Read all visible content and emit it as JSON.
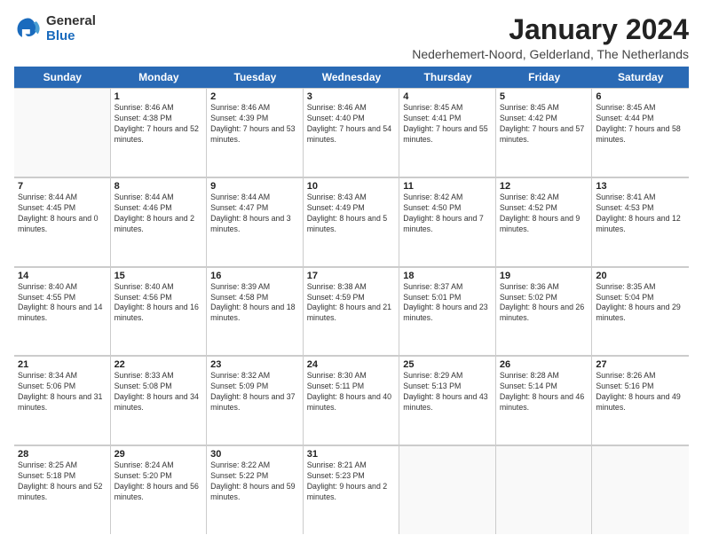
{
  "logo": {
    "general": "General",
    "blue": "Blue"
  },
  "title": "January 2024",
  "location": "Nederhemert-Noord, Gelderland, The Netherlands",
  "days": [
    "Sunday",
    "Monday",
    "Tuesday",
    "Wednesday",
    "Thursday",
    "Friday",
    "Saturday"
  ],
  "weeks": [
    [
      {
        "day": "",
        "sunrise": "",
        "sunset": "",
        "daylight": "",
        "empty": true
      },
      {
        "day": "1",
        "sunrise": "Sunrise: 8:46 AM",
        "sunset": "Sunset: 4:38 PM",
        "daylight": "Daylight: 7 hours and 52 minutes."
      },
      {
        "day": "2",
        "sunrise": "Sunrise: 8:46 AM",
        "sunset": "Sunset: 4:39 PM",
        "daylight": "Daylight: 7 hours and 53 minutes."
      },
      {
        "day": "3",
        "sunrise": "Sunrise: 8:46 AM",
        "sunset": "Sunset: 4:40 PM",
        "daylight": "Daylight: 7 hours and 54 minutes."
      },
      {
        "day": "4",
        "sunrise": "Sunrise: 8:45 AM",
        "sunset": "Sunset: 4:41 PM",
        "daylight": "Daylight: 7 hours and 55 minutes."
      },
      {
        "day": "5",
        "sunrise": "Sunrise: 8:45 AM",
        "sunset": "Sunset: 4:42 PM",
        "daylight": "Daylight: 7 hours and 57 minutes."
      },
      {
        "day": "6",
        "sunrise": "Sunrise: 8:45 AM",
        "sunset": "Sunset: 4:44 PM",
        "daylight": "Daylight: 7 hours and 58 minutes."
      }
    ],
    [
      {
        "day": "7",
        "sunrise": "Sunrise: 8:44 AM",
        "sunset": "Sunset: 4:45 PM",
        "daylight": "Daylight: 8 hours and 0 minutes."
      },
      {
        "day": "8",
        "sunrise": "Sunrise: 8:44 AM",
        "sunset": "Sunset: 4:46 PM",
        "daylight": "Daylight: 8 hours and 2 minutes."
      },
      {
        "day": "9",
        "sunrise": "Sunrise: 8:44 AM",
        "sunset": "Sunset: 4:47 PM",
        "daylight": "Daylight: 8 hours and 3 minutes."
      },
      {
        "day": "10",
        "sunrise": "Sunrise: 8:43 AM",
        "sunset": "Sunset: 4:49 PM",
        "daylight": "Daylight: 8 hours and 5 minutes."
      },
      {
        "day": "11",
        "sunrise": "Sunrise: 8:42 AM",
        "sunset": "Sunset: 4:50 PM",
        "daylight": "Daylight: 8 hours and 7 minutes."
      },
      {
        "day": "12",
        "sunrise": "Sunrise: 8:42 AM",
        "sunset": "Sunset: 4:52 PM",
        "daylight": "Daylight: 8 hours and 9 minutes."
      },
      {
        "day": "13",
        "sunrise": "Sunrise: 8:41 AM",
        "sunset": "Sunset: 4:53 PM",
        "daylight": "Daylight: 8 hours and 12 minutes."
      }
    ],
    [
      {
        "day": "14",
        "sunrise": "Sunrise: 8:40 AM",
        "sunset": "Sunset: 4:55 PM",
        "daylight": "Daylight: 8 hours and 14 minutes."
      },
      {
        "day": "15",
        "sunrise": "Sunrise: 8:40 AM",
        "sunset": "Sunset: 4:56 PM",
        "daylight": "Daylight: 8 hours and 16 minutes."
      },
      {
        "day": "16",
        "sunrise": "Sunrise: 8:39 AM",
        "sunset": "Sunset: 4:58 PM",
        "daylight": "Daylight: 8 hours and 18 minutes."
      },
      {
        "day": "17",
        "sunrise": "Sunrise: 8:38 AM",
        "sunset": "Sunset: 4:59 PM",
        "daylight": "Daylight: 8 hours and 21 minutes."
      },
      {
        "day": "18",
        "sunrise": "Sunrise: 8:37 AM",
        "sunset": "Sunset: 5:01 PM",
        "daylight": "Daylight: 8 hours and 23 minutes."
      },
      {
        "day": "19",
        "sunrise": "Sunrise: 8:36 AM",
        "sunset": "Sunset: 5:02 PM",
        "daylight": "Daylight: 8 hours and 26 minutes."
      },
      {
        "day": "20",
        "sunrise": "Sunrise: 8:35 AM",
        "sunset": "Sunset: 5:04 PM",
        "daylight": "Daylight: 8 hours and 29 minutes."
      }
    ],
    [
      {
        "day": "21",
        "sunrise": "Sunrise: 8:34 AM",
        "sunset": "Sunset: 5:06 PM",
        "daylight": "Daylight: 8 hours and 31 minutes."
      },
      {
        "day": "22",
        "sunrise": "Sunrise: 8:33 AM",
        "sunset": "Sunset: 5:08 PM",
        "daylight": "Daylight: 8 hours and 34 minutes."
      },
      {
        "day": "23",
        "sunrise": "Sunrise: 8:32 AM",
        "sunset": "Sunset: 5:09 PM",
        "daylight": "Daylight: 8 hours and 37 minutes."
      },
      {
        "day": "24",
        "sunrise": "Sunrise: 8:30 AM",
        "sunset": "Sunset: 5:11 PM",
        "daylight": "Daylight: 8 hours and 40 minutes."
      },
      {
        "day": "25",
        "sunrise": "Sunrise: 8:29 AM",
        "sunset": "Sunset: 5:13 PM",
        "daylight": "Daylight: 8 hours and 43 minutes."
      },
      {
        "day": "26",
        "sunrise": "Sunrise: 8:28 AM",
        "sunset": "Sunset: 5:14 PM",
        "daylight": "Daylight: 8 hours and 46 minutes."
      },
      {
        "day": "27",
        "sunrise": "Sunrise: 8:26 AM",
        "sunset": "Sunset: 5:16 PM",
        "daylight": "Daylight: 8 hours and 49 minutes."
      }
    ],
    [
      {
        "day": "28",
        "sunrise": "Sunrise: 8:25 AM",
        "sunset": "Sunset: 5:18 PM",
        "daylight": "Daylight: 8 hours and 52 minutes."
      },
      {
        "day": "29",
        "sunrise": "Sunrise: 8:24 AM",
        "sunset": "Sunset: 5:20 PM",
        "daylight": "Daylight: 8 hours and 56 minutes."
      },
      {
        "day": "30",
        "sunrise": "Sunrise: 8:22 AM",
        "sunset": "Sunset: 5:22 PM",
        "daylight": "Daylight: 8 hours and 59 minutes."
      },
      {
        "day": "31",
        "sunrise": "Sunrise: 8:21 AM",
        "sunset": "Sunset: 5:23 PM",
        "daylight": "Daylight: 9 hours and 2 minutes."
      },
      {
        "day": "",
        "sunrise": "",
        "sunset": "",
        "daylight": "",
        "empty": true
      },
      {
        "day": "",
        "sunrise": "",
        "sunset": "",
        "daylight": "",
        "empty": true
      },
      {
        "day": "",
        "sunrise": "",
        "sunset": "",
        "daylight": "",
        "empty": true
      }
    ]
  ]
}
